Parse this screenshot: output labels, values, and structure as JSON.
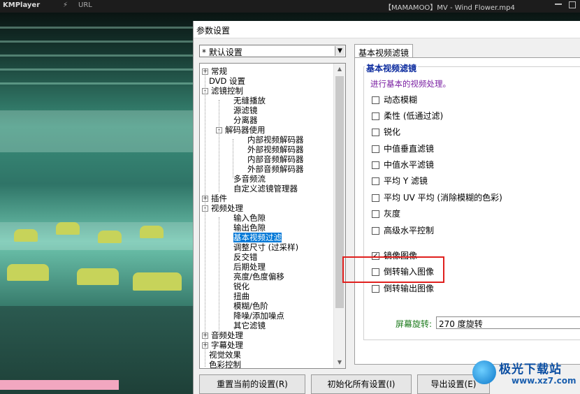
{
  "player": {
    "logo": "KMPlayer",
    "bolt": "⚡",
    "url_label": "URL",
    "file_title": "【MAMAMOO】MV - Wind Flower.mp4"
  },
  "dialog": {
    "title": "参数设置",
    "preset": "* 默认设置",
    "tab": "基本视频滤镜"
  },
  "tree": [
    {
      "label": "常规",
      "exp": "+"
    },
    {
      "label": "DVD 设置",
      "exp": ""
    },
    {
      "label": "滤镜控制",
      "exp": "-"
    },
    {
      "label": "无缝播放",
      "exp": ""
    },
    {
      "label": "源滤镜",
      "exp": ""
    },
    {
      "label": "分离器",
      "exp": ""
    },
    {
      "label": "解码器使用",
      "exp": "-"
    },
    {
      "label": "内部视频解码器",
      "exp": ""
    },
    {
      "label": "外部视频解码器",
      "exp": ""
    },
    {
      "label": "内部音频解码器",
      "exp": ""
    },
    {
      "label": "外部音频解码器",
      "exp": ""
    },
    {
      "label": "多音频流",
      "exp": ""
    },
    {
      "label": "自定义滤镜管理器",
      "exp": ""
    },
    {
      "label": "插件",
      "exp": "+"
    },
    {
      "label": "视频处理",
      "exp": "-"
    },
    {
      "label": "输入色隙",
      "exp": ""
    },
    {
      "label": "输出色隙",
      "exp": ""
    },
    {
      "label": "基本视频过滤",
      "exp": "",
      "selected": true
    },
    {
      "label": "调整尺寸 (过采样)",
      "exp": ""
    },
    {
      "label": "反交错",
      "exp": ""
    },
    {
      "label": "后期处理",
      "exp": ""
    },
    {
      "label": "亮度/色度偏移",
      "exp": ""
    },
    {
      "label": "锐化",
      "exp": ""
    },
    {
      "label": "扭曲",
      "exp": ""
    },
    {
      "label": "模糊/色阶",
      "exp": ""
    },
    {
      "label": "降噪/添加噪点",
      "exp": ""
    },
    {
      "label": "其它滤镜",
      "exp": ""
    },
    {
      "label": "音频处理",
      "exp": "+"
    },
    {
      "label": "字幕处理",
      "exp": "+"
    },
    {
      "label": "视觉效果",
      "exp": ""
    },
    {
      "label": "色彩控制",
      "exp": ""
    }
  ],
  "filters": {
    "group_title": "基本视频滤镜",
    "description": "进行基本的视频处理。",
    "options": [
      {
        "label": "动态模糊",
        "checked": false
      },
      {
        "label": "柔性 (低通过滤)",
        "checked": false
      },
      {
        "label": "锐化",
        "checked": false
      },
      {
        "label": "中值垂直滤镜",
        "checked": false
      },
      {
        "label": "中值水平滤镜",
        "checked": false
      },
      {
        "label": "平均 Y 滤镜",
        "checked": false
      },
      {
        "label": "平均 UV 平均 (消除模糊的色彩)",
        "checked": false
      },
      {
        "label": "灰度",
        "checked": false
      },
      {
        "label": "高级水平控制",
        "checked": false
      },
      {
        "label": "镜像图像",
        "checked": true
      },
      {
        "label": "倒转输入图像",
        "checked": false
      },
      {
        "label": "倒转输出图像",
        "checked": false
      }
    ],
    "rotate_label": "屏幕旋转:",
    "rotate_value": "270 度旋转"
  },
  "buttons": {
    "reset": "重置当前的设置(R)",
    "init_all": "初始化所有设置(I)",
    "export": "导出设置(E)"
  },
  "watermark": {
    "name": "极光下载站",
    "url": "www.xz7.com"
  },
  "colors": {
    "accent": "#0078d7",
    "group_title": "#0a2a9e",
    "description": "#7a1fa2",
    "highlight": "#e0201e"
  }
}
